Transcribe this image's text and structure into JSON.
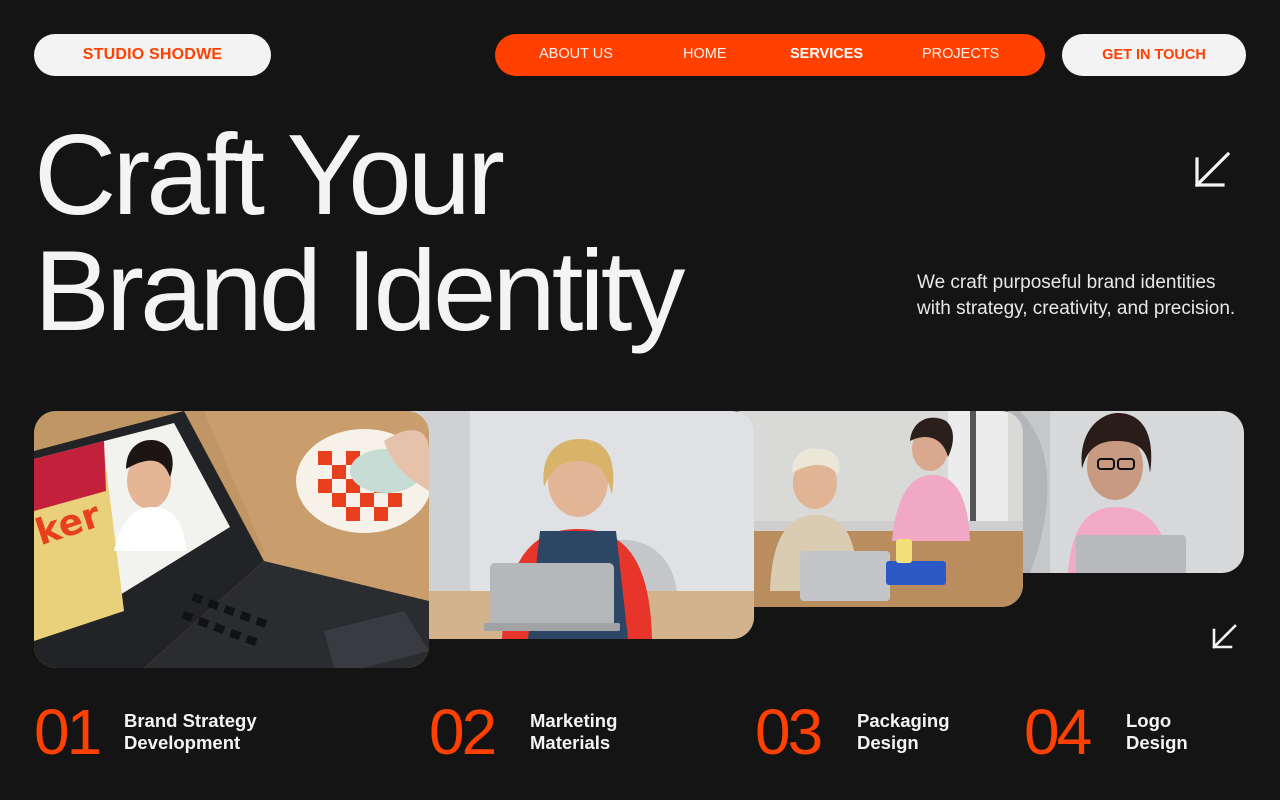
{
  "brand": {
    "name": "STUDIO SHODWE"
  },
  "nav": {
    "items": [
      {
        "label": "ABOUT US",
        "active": false
      },
      {
        "label": "HOME",
        "active": false
      },
      {
        "label": "SERVICES",
        "active": true
      },
      {
        "label": "PROJECTS",
        "active": false
      }
    ]
  },
  "cta": {
    "label": "GET IN TOUCH"
  },
  "hero": {
    "title_line1": "Craft Your",
    "title_line2": "Brand Identity",
    "description": "We craft purposeful brand identities with strategy, creativity, and precision."
  },
  "icons": {
    "hero_arrow": "arrow-down-left-icon",
    "gallery_arrow": "arrow-down-left-icon"
  },
  "gallery": {
    "photos": [
      {
        "subject": "photo-laptop-mousepad"
      },
      {
        "subject": "photo-woman-laptop"
      },
      {
        "subject": "photo-team-meeting"
      },
      {
        "subject": "photo-woman-glasses"
      }
    ]
  },
  "services": [
    {
      "number": "01",
      "line1": "Brand Strategy",
      "line2": "Development"
    },
    {
      "number": "02",
      "line1": "Marketing",
      "line2": "Materials"
    },
    {
      "number": "03",
      "line1": "Packaging",
      "line2": "Design"
    },
    {
      "number": "04",
      "line1": "Logo",
      "line2": "Design"
    }
  ],
  "colors": {
    "background": "#141414",
    "accent": "#ff4000",
    "pill": "#f3f3f3",
    "text": "#f4f4f4"
  }
}
